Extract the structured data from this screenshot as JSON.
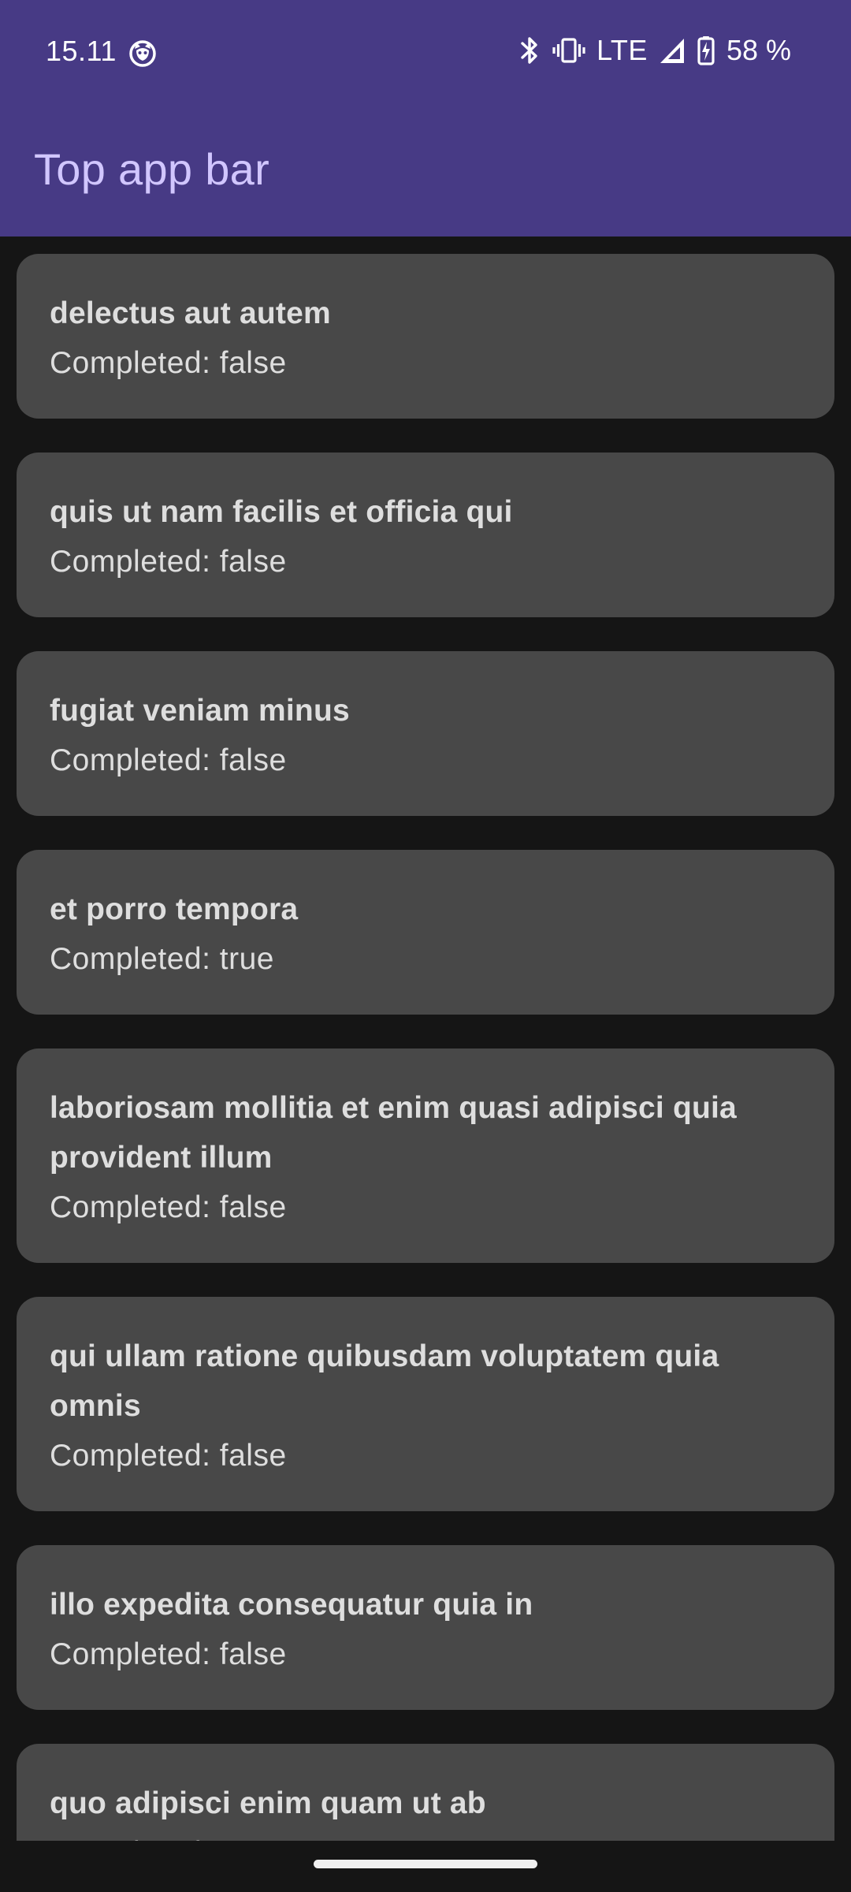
{
  "status_bar": {
    "time": "15.11",
    "network": "LTE",
    "battery": "58 %"
  },
  "app_bar": {
    "title": "Top app bar"
  },
  "todos": [
    {
      "title": "delectus aut autem",
      "status": "Completed: false"
    },
    {
      "title": "quis ut nam facilis et officia qui",
      "status": "Completed: false"
    },
    {
      "title": "fugiat veniam minus",
      "status": "Completed: false"
    },
    {
      "title": "et porro tempora",
      "status": "Completed: true"
    },
    {
      "title": "laboriosam mollitia et enim quasi adipisci quia provident illum",
      "status": "Completed: false"
    },
    {
      "title": "qui ullam ratione quibusdam voluptatem quia omnis",
      "status": "Completed: false"
    },
    {
      "title": "illo expedita consequatur quia in",
      "status": "Completed: false"
    },
    {
      "title": "quo adipisci enim quam ut ab",
      "status": "Completed: true"
    }
  ],
  "colors": {
    "app_bar": "#473a85",
    "app_bar_title": "#d1c6ff",
    "background": "#151515",
    "card": "#484848",
    "card_text": "#dedede"
  },
  "icons": {
    "notification": "cat-face-icon",
    "bluetooth": "bluetooth-icon",
    "vibrate": "vibrate-icon",
    "signal": "signal-icon",
    "battery": "battery-charging-icon"
  }
}
